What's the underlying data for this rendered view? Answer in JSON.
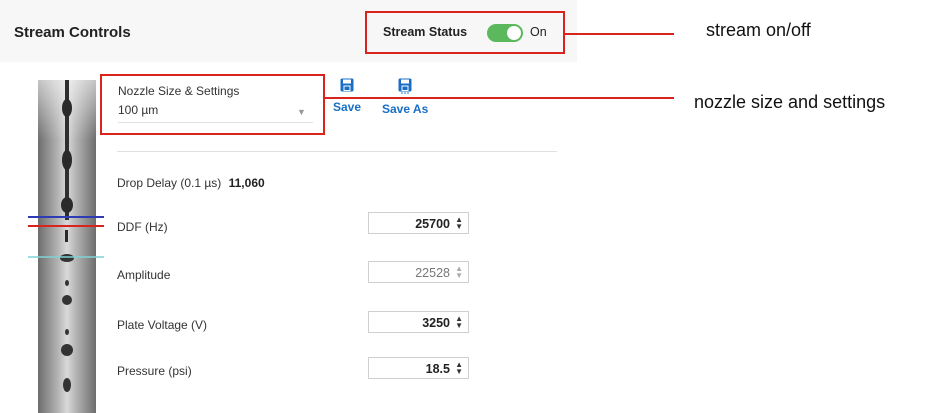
{
  "header": {
    "title": "Stream Controls"
  },
  "status": {
    "label": "Stream Status",
    "state": "On",
    "enabled": true
  },
  "nozzle": {
    "label": "Nozzle Size & Settings",
    "value": "100 µm"
  },
  "actions": {
    "save_label": "Save",
    "save_as_label": "Save As"
  },
  "drop_delay": {
    "label": "Drop Delay (0.1 µs)",
    "value": "11,060"
  },
  "fields": [
    {
      "label": "DDF (Hz)",
      "value": "25700",
      "disabled": false
    },
    {
      "label": "Amplitude",
      "value": "22528",
      "disabled": true
    },
    {
      "label": "Plate Voltage (V)",
      "value": "3250",
      "disabled": false
    },
    {
      "label": "Pressure (psi)",
      "value": "18.5",
      "disabled": false
    }
  ],
  "annotations": {
    "stream": "stream on/off",
    "nozzle": "nozzle size and settings"
  },
  "colors": {
    "accent": "#1a6fc4",
    "toggle_on": "#5cb85c",
    "callout": "#d9231d",
    "marker_blue": "#2f3bb5",
    "marker_red": "#d9231d",
    "marker_cyan": "#7fd3d6"
  }
}
